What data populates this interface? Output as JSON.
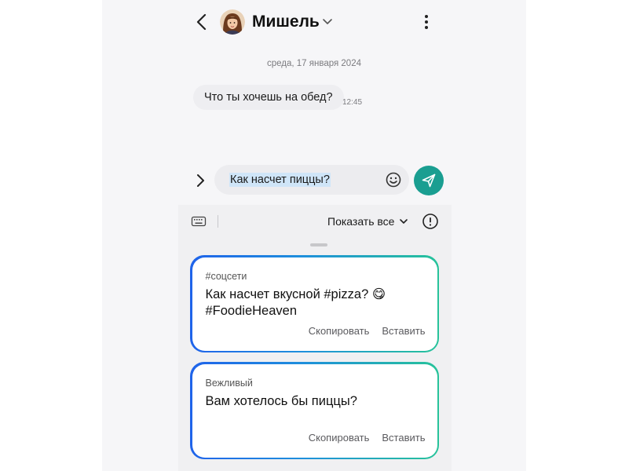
{
  "header": {
    "contact_name": "Мишель"
  },
  "conversation": {
    "date_separator": "среда, 17 января 2024",
    "messages": [
      {
        "text": "Что ты хочешь на обед?",
        "time": "12:45"
      }
    ]
  },
  "composer": {
    "input_value": "Как насчет пиццы?"
  },
  "suggestions_panel": {
    "show_all_label": "Показать все",
    "cards": [
      {
        "tag": "#соцсети",
        "text": "Как насчет вкусной #pizza? 😋 #FoodieHeaven",
        "copy_label": "Скопировать",
        "insert_label": "Вставить"
      },
      {
        "tag": "Вежливый",
        "text": "Вам хотелось бы пиццы?",
        "copy_label": "Скопировать",
        "insert_label": "Вставить"
      }
    ]
  },
  "icons": {
    "back": "back-chevron-icon",
    "more": "more-vertical-icon",
    "expand": "chevron-right-icon",
    "emoji": "smiley-icon",
    "send": "send-icon",
    "keyboard": "keyboard-icon",
    "info": "info-icon"
  },
  "colors": {
    "send_button": "#1a9e91",
    "card_gradient_start": "#1f63ea",
    "card_gradient_end": "#27c39a",
    "text_selection": "#cfe5f8"
  }
}
